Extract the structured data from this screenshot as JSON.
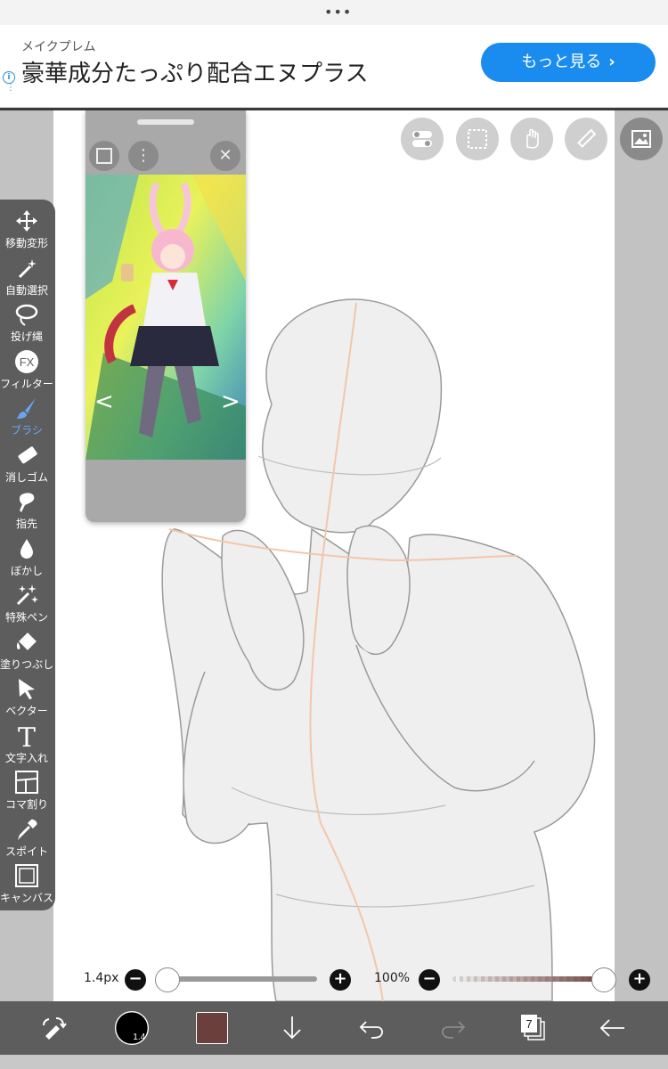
{
  "ad": {
    "sponsor": "メイクプレム",
    "title": "豪華成分たっぷり配合エヌプラス",
    "cta": "もっと見る",
    "cta_chevron": "›",
    "info": "i",
    "menu": "⋮"
  },
  "statusbar": {
    "dots": "•••"
  },
  "top_tools": [
    "toggle-icon",
    "selection-icon",
    "hand-icon",
    "ruler-icon",
    "layer-image-icon"
  ],
  "toolbar": {
    "tools": [
      {
        "label": "移動変形",
        "icon": "move-icon"
      },
      {
        "label": "自動選択",
        "icon": "magic-wand-icon"
      },
      {
        "label": "投げ縄",
        "icon": "lasso-icon"
      },
      {
        "label": "フィルター",
        "icon": "fx-icon"
      },
      {
        "label": "ブラシ",
        "icon": "brush-icon"
      },
      {
        "label": "消しゴム",
        "icon": "eraser-icon"
      },
      {
        "label": "指先",
        "icon": "finger-icon"
      },
      {
        "label": "ぼかし",
        "icon": "blur-icon"
      },
      {
        "label": "特殊ペン",
        "icon": "special-pen-icon"
      },
      {
        "label": "塗りつぶし",
        "icon": "fill-icon"
      },
      {
        "label": "ベクター",
        "icon": "vector-icon"
      },
      {
        "label": "文字入れ",
        "icon": "text-icon"
      },
      {
        "label": "コマ割り",
        "icon": "panel-icon"
      },
      {
        "label": "スポイト",
        "icon": "eyedropper-icon"
      },
      {
        "label": "キャンバス",
        "icon": "canvas-icon"
      }
    ],
    "active": "ブラシ",
    "fx_text": "FX",
    "text_glyph": "T"
  },
  "reference_panel": {
    "prev": "<",
    "next": ">",
    "close": "✕",
    "menu": "⋮"
  },
  "sliders": {
    "size_label": "1.4px",
    "size_fraction": 0.0,
    "opacity_label": "100%",
    "opacity_fraction": 1.0,
    "minus": "−",
    "plus": "+"
  },
  "bottombar": {
    "brush_size": "1.4",
    "color": "#6b3f3c",
    "layer_count": "7"
  },
  "colors": {
    "toolbar": "#5d5d5d",
    "accent": "#1a8cf0",
    "active_tool": "#6aa6f0"
  }
}
